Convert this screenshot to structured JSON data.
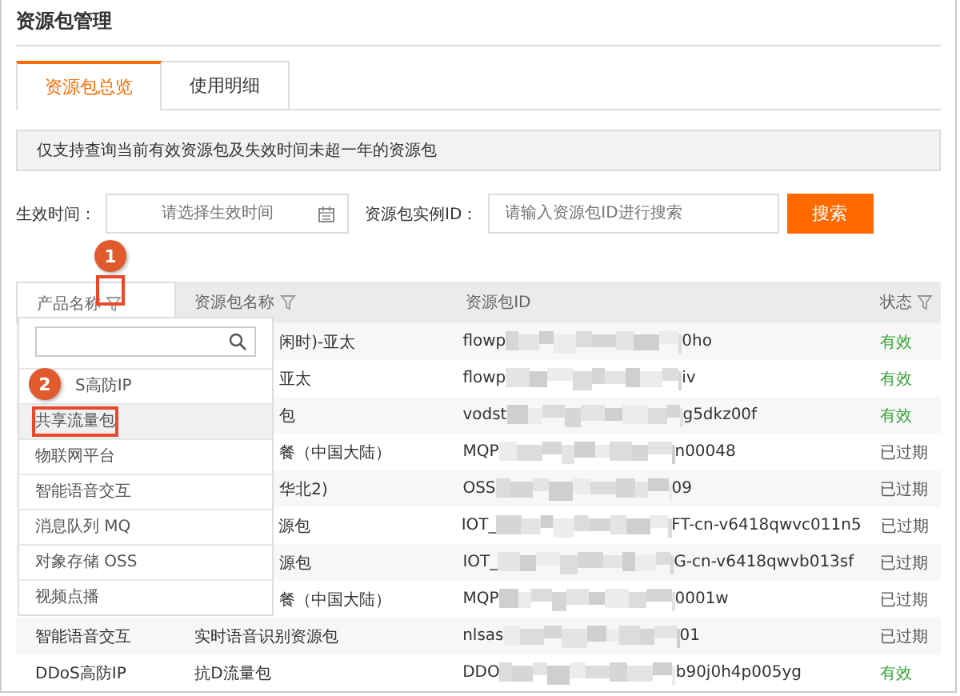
{
  "page_title": "资源包管理",
  "tabs": [
    {
      "label": "资源包总览",
      "selected": true
    },
    {
      "label": "使用明细",
      "selected": false
    }
  ],
  "notice": "仅支持查询当前有效资源包及失效时间未超一年的资源包",
  "filters": [
    {
      "label": "生效时间：",
      "placeholder": "请选择生效时间",
      "kind": "date"
    },
    {
      "label": "资源包实例ID：",
      "placeholder": "请输入资源包ID进行搜索",
      "kind": "text"
    }
  ],
  "search_button": "搜索",
  "table": {
    "columns": [
      {
        "label": "产品名称",
        "filter": true,
        "active": true
      },
      {
        "label": "资源包名称",
        "filter": true,
        "active": false
      },
      {
        "label": "资源包ID",
        "filter": false,
        "active": false
      },
      {
        "label": "状态",
        "filter": true,
        "active": false
      }
    ],
    "rows": [
      {
        "name": "闲时)-亚太",
        "id_prefix": "flowp",
        "id_suffix": "0ho",
        "status": "有效",
        "valid": true
      },
      {
        "name": "亚太",
        "id_prefix": "flowp",
        "id_suffix": "iv",
        "status": "有效",
        "valid": true
      },
      {
        "name": "包",
        "id_prefix": "vodst",
        "id_suffix": "g5dkz00f",
        "status": "有效",
        "valid": true
      },
      {
        "name": "餐（中国大陆）",
        "id_prefix": "MQP",
        "id_suffix": "n00048",
        "status": "已过期",
        "valid": false
      },
      {
        "name": "华北2)",
        "id_prefix": "OSS",
        "id_suffix": "09",
        "status": "已过期",
        "valid": false
      },
      {
        "name": "源包",
        "id_prefix": "IOT_",
        "id_suffix": "FT-cn-v6418qwvc011n5",
        "status": "已过期",
        "valid": false
      },
      {
        "name": "源包",
        "id_prefix": "IOT_",
        "id_suffix": "G-cn-v6418qwvb013sf",
        "status": "已过期",
        "valid": false
      },
      {
        "name": "餐（中国大陆）",
        "id_prefix": "MQP",
        "id_suffix": "0001w",
        "status": "已过期",
        "valid": false
      },
      {
        "product": "智能语音交互",
        "name": "实时语音识别资源包",
        "id_prefix": "nlsas",
        "id_suffix": "01",
        "status": "已过期",
        "valid": false
      },
      {
        "product": "DDoS高防IP",
        "name": "抗D流量包",
        "id_prefix": "DDO",
        "id_suffix": "b90j0h4p005yg",
        "status": "有效",
        "valid": true
      }
    ]
  },
  "filter_dropdown": {
    "items": [
      {
        "label": "S高防IP",
        "selected": false,
        "partly_covered": true
      },
      {
        "label": "共享流量包",
        "selected": true
      },
      {
        "label": "物联网平台",
        "selected": false
      },
      {
        "label": "智能语音交互",
        "selected": false
      },
      {
        "label": "消息队列 MQ",
        "selected": false
      },
      {
        "label": "对象存储 OSS",
        "selected": false
      },
      {
        "label": "视频点播",
        "selected": false
      }
    ]
  },
  "callouts": [
    {
      "number": "1"
    },
    {
      "number": "2"
    }
  ]
}
